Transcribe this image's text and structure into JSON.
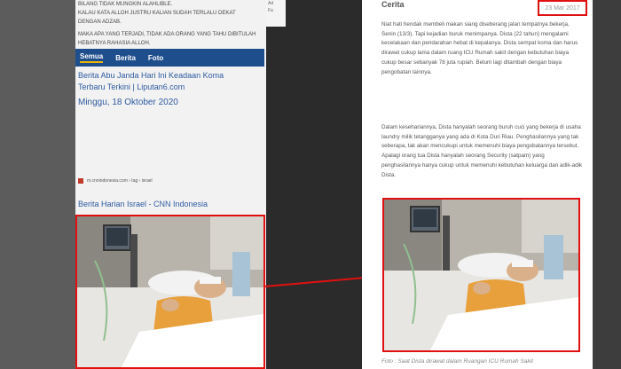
{
  "left_panel": {
    "top_lines": [
      "BILANG TIDAK MUNGKIN ALAHLIBLE.",
      "KALAU KATA ALLOH JUSTRU KALIAN SUDAH TERLALU DEKAT",
      "DENGAN ADZAB.",
      "MAKA APA YANG TERJADI, TIDAK ADA ORANG YANG TAHU DIBITULAH",
      "HEBATNYA RAHASIA ALLOH."
    ],
    "tabs": [
      "Semua",
      "Berita",
      "Foto"
    ],
    "headline_1": "Berita Abu Janda Hari Ini  Keadaan Koma",
    "headline_2": "Terbaru Terkini | Liputan6.com",
    "date": "Minggu, 18 Oktober 2020",
    "source": "m.cnnindonesia.com › tag › israel",
    "result_title": "Berita Harian Israel - CNN Indonesia"
  },
  "strip_text": [
    "Ad",
    "Fa"
  ],
  "right_panel": {
    "category": "Cerita",
    "date": "23 Mar 2017",
    "paragraph_1": "Niat hati hendak membeli makan siang diseberang jalan tempatnya bekerja, Senin (13/3). Tapi kejadian buruk menimpanya. Dista (22 tahun) mengalami kecelakaan dan pendarahan hebat di kepalanya. Dista sempat koma dan harus dirawat cukup lama dalam ruang ICU Rumah sakit dengan kebutuhan biaya cukup besar sebanyak 78 juta rupiah. Belum lagi ditambah dengan biaya pengobatan lainnya.",
    "paragraph_2": "Dalam kesehariannya, Dista hanyalah seorang buruh cuci yang bekerja di usaha laundry milik tetangganya yang ada di Kota Duri Riau. Penghasilannya yang tak seberapa, tak akan mencukupi untuk memenuhi biaya pengobatannya tersebut. Apalagi orang tua Dista hanyalah seorang Security (satpam) yang penghasilannya hanya cukup untuk memenuhi kebutuhan keluarga dan adik-adik Dista.",
    "caption": "Foto : Saat Dista dirawat dalam Ruangan ICU Rumah Sakit"
  },
  "colors": {
    "highlight": "#e01010",
    "tab_bar": "#1e4e8c",
    "link": "#2d5aa0"
  }
}
